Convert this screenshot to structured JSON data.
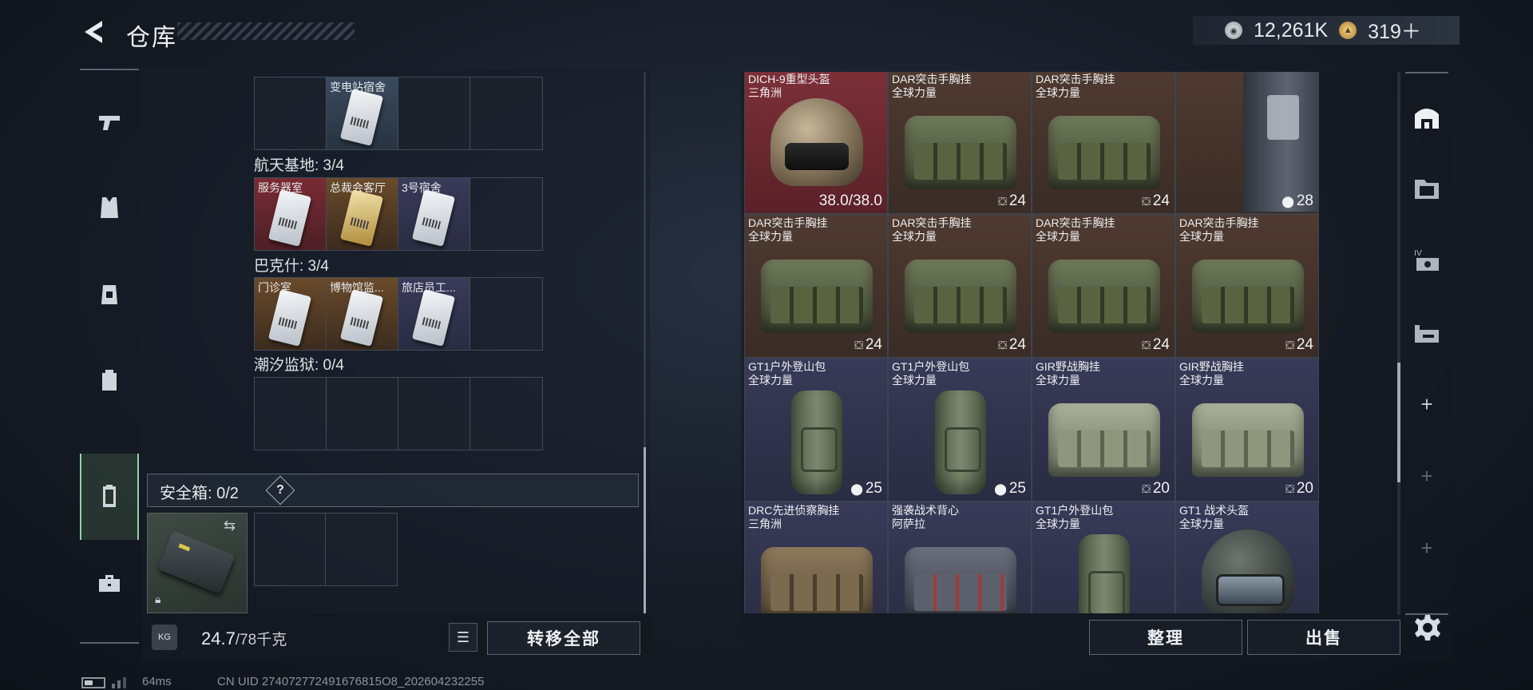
{
  "header": {
    "title": "仓库",
    "currencies": [
      {
        "icon": "silver-coin-icon",
        "value": "12,261K"
      },
      {
        "icon": "gold-coin-icon",
        "value": "319＋"
      }
    ]
  },
  "left_nav": {
    "items": [
      {
        "name": "weapons",
        "icon": "pistol-icon"
      },
      {
        "name": "armor",
        "icon": "vest-icon"
      },
      {
        "name": "chest-rig",
        "icon": "rig-icon"
      },
      {
        "name": "backpack",
        "icon": "backpack-icon"
      },
      {
        "name": "safe-box",
        "icon": "safe-box-icon",
        "active": true
      },
      {
        "name": "items",
        "icon": "toolbox-icon"
      }
    ]
  },
  "keycards": {
    "rows": [
      {
        "section": null,
        "slots": [
          {
            "label": "",
            "color": "empty"
          },
          {
            "label": "变电站宿舍",
            "color": "blue",
            "card": true
          },
          {
            "label": "",
            "color": "empty"
          },
          {
            "label": "",
            "color": "empty"
          }
        ]
      },
      {
        "section": "航天基地: 3/4",
        "slots": [
          {
            "label": "服务器室",
            "color": "red",
            "card": true
          },
          {
            "label": "总裁会客厅",
            "color": "gold",
            "card": true,
            "goldcard": true
          },
          {
            "label": "3号宿舍",
            "color": "purple",
            "card": true
          },
          {
            "label": "",
            "color": "empty"
          }
        ]
      },
      {
        "section": "巴克什: 3/4",
        "slots": [
          {
            "label": "门诊室",
            "color": "gold",
            "card": true
          },
          {
            "label": "博物馆监...",
            "color": "gold",
            "card": true
          },
          {
            "label": "旅店员工...",
            "color": "purple",
            "card": true
          },
          {
            "label": "",
            "color": "empty"
          }
        ]
      },
      {
        "section": "潮汐监狱: 0/4",
        "slots": [
          {
            "label": "",
            "color": "empty"
          },
          {
            "label": "",
            "color": "empty"
          },
          {
            "label": "",
            "color": "empty"
          },
          {
            "label": "",
            "color": "empty"
          }
        ]
      }
    ]
  },
  "safe": {
    "label": "安全箱:  0/2",
    "help": "?"
  },
  "weight": {
    "current": "24.7",
    "max": "/78千克",
    "icon_text": "KG"
  },
  "buttons": {
    "transfer_all": "转移全部",
    "sort": "整理",
    "sell": "出售"
  },
  "warehouse": {
    "items": [
      {
        "name": "DICH-9重型头盔",
        "sub": "三角洲",
        "color": "red",
        "art": "helmet",
        "count": "38.0/38.0",
        "count_icon": ""
      },
      {
        "name": "DAR突击手胸挂",
        "sub": "全球力量",
        "color": "brown",
        "art": "vest",
        "count": "24",
        "count_icon": "rig"
      },
      {
        "name": "DAR突击手胸挂",
        "sub": "全球力量",
        "color": "brown",
        "art": "vest",
        "count": "24",
        "count_icon": "rig"
      },
      {
        "name": "",
        "sub": "",
        "color": "brown",
        "art": "tallvest",
        "count": "28",
        "count_icon": "bag"
      },
      {
        "name": "DAR突击手胸挂",
        "sub": "全球力量",
        "color": "brown",
        "art": "vest",
        "count": "24",
        "count_icon": "rig"
      },
      {
        "name": "DAR突击手胸挂",
        "sub": "全球力量",
        "color": "brown",
        "art": "vest",
        "count": "24",
        "count_icon": "rig"
      },
      {
        "name": "DAR突击手胸挂",
        "sub": "全球力量",
        "color": "brown",
        "art": "vest",
        "count": "24",
        "count_icon": "rig"
      },
      {
        "name": "DAR突击手胸挂",
        "sub": "全球力量",
        "color": "brown",
        "art": "vest",
        "count": "24",
        "count_icon": "rig"
      },
      {
        "name": "GT1户外登山包",
        "sub": "全球力量",
        "color": "purple",
        "art": "pack",
        "count": "25",
        "count_icon": "bag"
      },
      {
        "name": "GT1户外登山包",
        "sub": "全球力量",
        "color": "purple",
        "art": "pack",
        "count": "25",
        "count_icon": "bag"
      },
      {
        "name": "GIR野战胸挂",
        "sub": "全球力量",
        "color": "purple",
        "art": "vest-light",
        "count": "20",
        "count_icon": "rig"
      },
      {
        "name": "GIR野战胸挂",
        "sub": "全球力量",
        "color": "purple",
        "art": "vest-light",
        "count": "20",
        "count_icon": "rig"
      },
      {
        "name": "DRC先进侦察胸挂",
        "sub": "三角洲",
        "color": "purple",
        "art": "vest-tan",
        "count": "",
        "count_icon": ""
      },
      {
        "name": "强袭战术背心",
        "sub": "阿萨拉",
        "color": "purple",
        "art": "vest-grey",
        "count": "",
        "count_icon": ""
      },
      {
        "name": "GT1户外登山包",
        "sub": "全球力量",
        "color": "purple",
        "art": "pack",
        "count": "",
        "count_icon": ""
      },
      {
        "name": "GT1 战术头盔",
        "sub": "全球力量",
        "color": "purple",
        "art": "helmet-dark",
        "count": "",
        "count_icon": ""
      }
    ]
  },
  "right_nav": {
    "items": [
      {
        "name": "warehouse-main",
        "icon": "warehouse-icon"
      },
      {
        "name": "folder",
        "icon": "folder-icon"
      },
      {
        "name": "tier-iv",
        "icon": "tier-iv-icon"
      },
      {
        "name": "weapon-case",
        "icon": "gun-case-icon"
      },
      {
        "name": "add",
        "icon": "plus-icon"
      },
      {
        "name": "add-locked",
        "icon": "plus-icon"
      },
      {
        "name": "add-locked-2",
        "icon": "plus-icon"
      }
    ]
  },
  "status": {
    "ping": "64ms",
    "uid": "CN UID 274072772491676815O8_202604232255"
  },
  "colors": {
    "accent_green": "#8fd3a5",
    "rarity_red": "#7c3038",
    "rarity_gold": "#6a4a2a",
    "rarity_purple": "#383a58"
  }
}
